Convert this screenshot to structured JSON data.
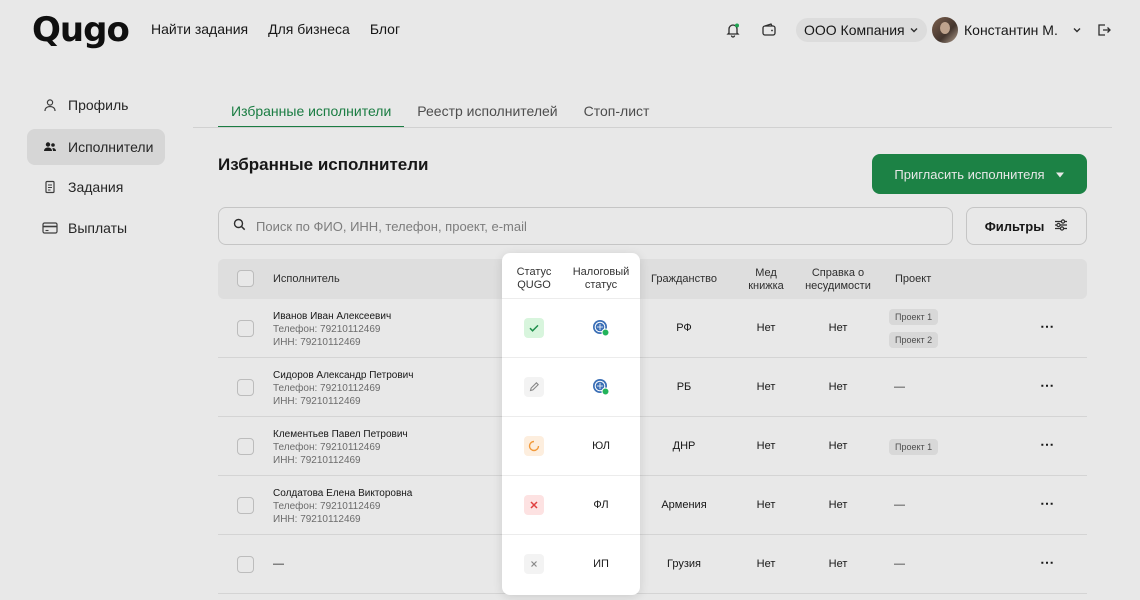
{
  "header": {
    "logo": "Qugo",
    "nav": [
      "Найти задания",
      "Для бизнеса",
      "Блог"
    ],
    "company": "ООО Компания",
    "user_name": "Константин М."
  },
  "sidebar": {
    "items": [
      {
        "label": "Профиль",
        "icon": "user-icon",
        "active": false
      },
      {
        "label": "Исполнители",
        "icon": "users-icon",
        "active": true
      },
      {
        "label": "Задания",
        "icon": "document-icon",
        "active": false
      },
      {
        "label": "Выплаты",
        "icon": "card-icon",
        "active": false
      }
    ]
  },
  "main": {
    "tabs": [
      {
        "label": "Избранные исполнители",
        "active": true
      },
      {
        "label": "Реестр исполнителей",
        "active": false
      },
      {
        "label": "Стоп-лист",
        "active": false
      }
    ],
    "title": "Избранные исполнители",
    "invite_button": "Пригласить исполнителя",
    "search_placeholder": "Поиск по ФИО, ИНН, телефон, проект, e-mail",
    "filters_button": "Фильтры"
  },
  "table": {
    "columns": {
      "executor": "Исполнитель",
      "status_qugo_1": "Статус",
      "status_qugo_2": "QUGO",
      "tax_status_1": "Налоговый",
      "tax_status_2": "статус",
      "citizenship": "Гражданство",
      "med_1": "Мед",
      "med_2": "книжка",
      "record_1": "Справка о",
      "record_2": "несудимости",
      "project": "Проект"
    },
    "rows": [
      {
        "name": "Иванов Иван Алексеевич",
        "phone": "Телефон: 79210112469",
        "inn": "ИНН: 79210112469",
        "status": "approved",
        "tax": "",
        "tax_icon": "gosuslugi-verified-icon",
        "citizenship": "РФ",
        "med": "Нет",
        "record": "Нет",
        "projects": [
          "Проект 1",
          "Проект 2"
        ]
      },
      {
        "name": "Сидоров Александр Петрович",
        "phone": "Телефон: 79210112469",
        "inn": "ИНН: 79210112469",
        "status": "edit",
        "tax": "",
        "tax_icon": "gosuslugi-verified-icon",
        "citizenship": "РБ",
        "med": "Нет",
        "record": "Нет",
        "projects": [
          "—"
        ]
      },
      {
        "name": "Клементьев Павел Петрович",
        "phone": "Телефон: 79210112469",
        "inn": "ИНН: 79210112469",
        "status": "pending",
        "tax": "ЮЛ",
        "citizenship": "ДНР",
        "med": "Нет",
        "record": "Нет",
        "projects": [
          "Проект 1"
        ]
      },
      {
        "name": "Солдатова Елена Викторовна",
        "phone": "Телефон: 79210112469",
        "inn": "ИНН: 79210112469",
        "status": "rejected",
        "tax": "ФЛ",
        "citizenship": "Армения",
        "med": "Нет",
        "record": "Нет",
        "projects": [
          "—"
        ]
      },
      {
        "name": "—",
        "phone": "",
        "inn": "",
        "status": "none",
        "tax": "ИП",
        "citizenship": "Грузия",
        "med": "Нет",
        "record": "Нет",
        "projects": [
          "—"
        ]
      }
    ]
  },
  "colors": {
    "accent": "#1f8f4c",
    "approved_bg": "#d8f5dd",
    "pending_bg": "#fdeede",
    "rejected_bg": "#fde2e2"
  }
}
